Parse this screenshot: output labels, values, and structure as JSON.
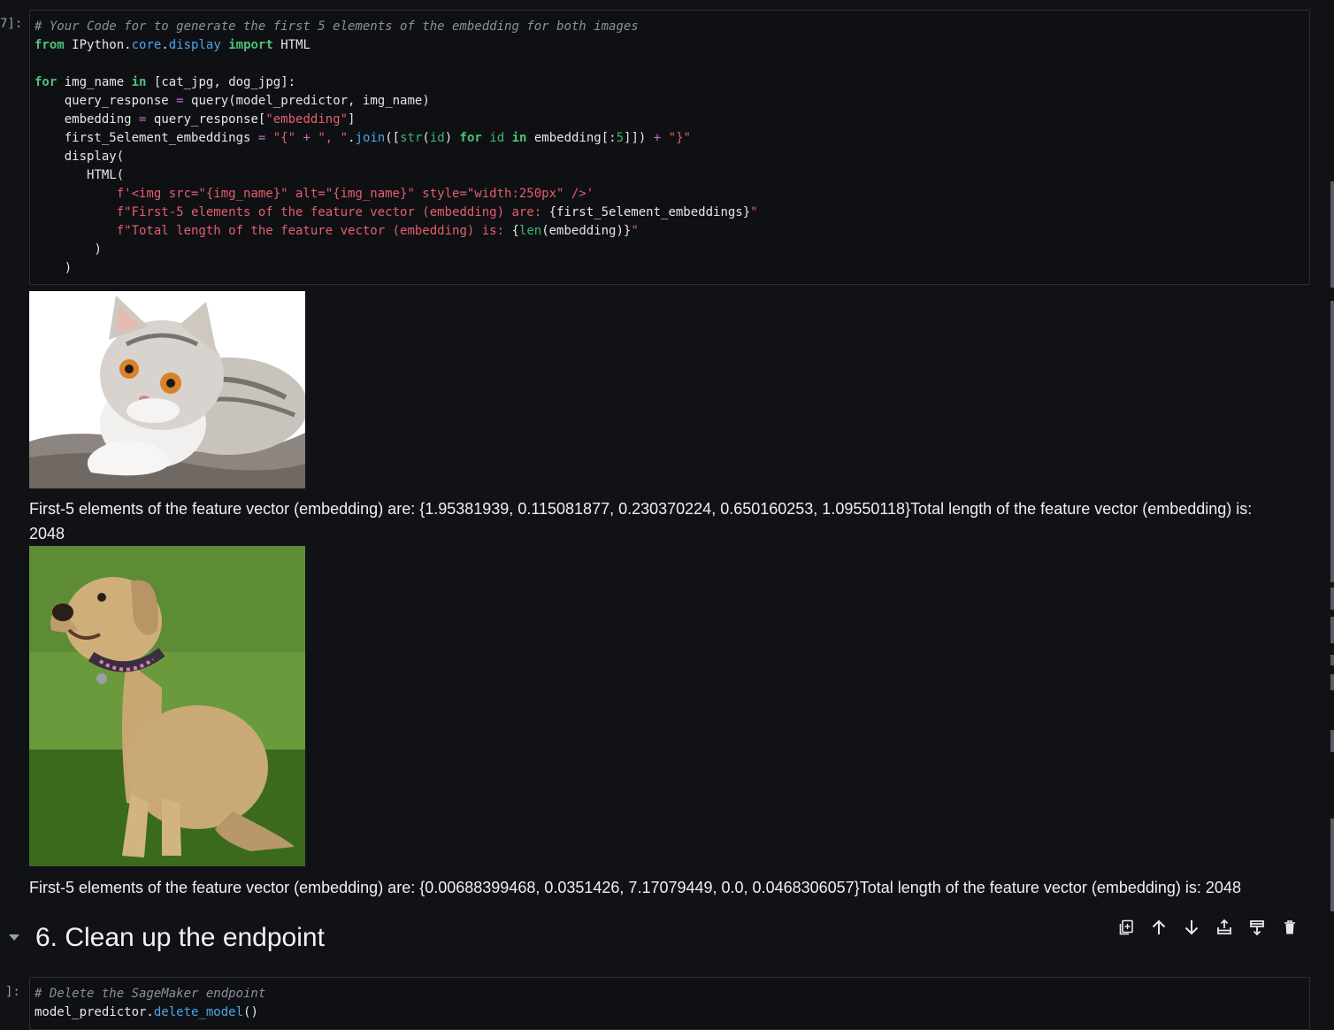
{
  "cell1": {
    "prompt": "7]:",
    "comment": "# Your Code for to generate the first 5 elements of the embedding for both images",
    "code": {
      "l2_from": "from",
      "l2_mod1": "IPython",
      "l2_mod2": "core",
      "l2_mod3": "display",
      "l2_import": "import",
      "l2_name": "HTML",
      "l4_for": "for",
      "l4_var": "img_name",
      "l4_in": "in",
      "l4_list": "[cat_jpg, dog_jpg]:",
      "l5_a": "query_response",
      "l5_eq": "=",
      "l5_b": "query(model_predictor, img_name)",
      "l6_a": "embedding",
      "l6_eq": "=",
      "l6_b": "query_response[",
      "l6_s": "\"embedding\"",
      "l6_c": "]",
      "l7_a": "first_5element_embeddings",
      "l7_eq": "=",
      "l7_s1": "\"{\"",
      "l7_plus1": "+",
      "l7_s2": "\", \"",
      "l7_join": "join",
      "l7_str": "str",
      "l7_id": "id",
      "l7_for": "for",
      "l7_id2": "id",
      "l7_in": "in",
      "l7_emb": "embedding[:",
      "l7_num": "5",
      "l7_close": "]])",
      "l7_plus2": "+",
      "l7_s3": "\"}\"",
      "l8": "display(",
      "l9": "HTML(",
      "l10": "f'<img src=\"{img_name}\" alt=\"{img_name}\" style=\"width:250px\" />'",
      "l11_s": "f\"First-5 elements of the feature vector (embedding) are: ",
      "l11_v": "{first_5element_embeddings}",
      "l11_e": "\"",
      "l12_s": "f\"Total length of the feature vector (embedding) is: ",
      "l12_o": "{",
      "l12_len": "len",
      "l12_v": "(embedding)}",
      "l12_e": "\"",
      "l13": ")",
      "l14": ")"
    }
  },
  "outputs": [
    {
      "image_name": "cat-photo",
      "text_line1": "First-5 elements of the feature vector (embedding) are: {1.95381939, 0.115081877, 0.230370224, 0.650160253, 1.09550118}Total length of the feature vector (embedding) is:",
      "text_line2": "2048"
    },
    {
      "image_name": "dog-photo",
      "text_line1": "First-5 elements of the feature vector (embedding) are: {0.00688399468, 0.0351426, 7.17079449, 0.0, 0.0468306057}Total length of the feature vector (embedding) is: 2048"
    }
  ],
  "section": {
    "heading": "6. Clean up the endpoint",
    "toolbar_icons": [
      "duplicate-icon",
      "move-up-icon",
      "move-down-icon",
      "insert-above-icon",
      "insert-below-icon",
      "delete-icon"
    ]
  },
  "cell2": {
    "prompt": "]:",
    "comment": "# Delete the SageMaker endpoint",
    "l2_a": "model_predictor.",
    "l2_b": "delete_model",
    "l2_c": "()"
  },
  "colors": {
    "background": "#111216",
    "keyword": "#4ec27a",
    "string": "#e45f6c",
    "attribute": "#4aa6e8",
    "operator": "#c76ecf",
    "comment": "#8a919a"
  }
}
